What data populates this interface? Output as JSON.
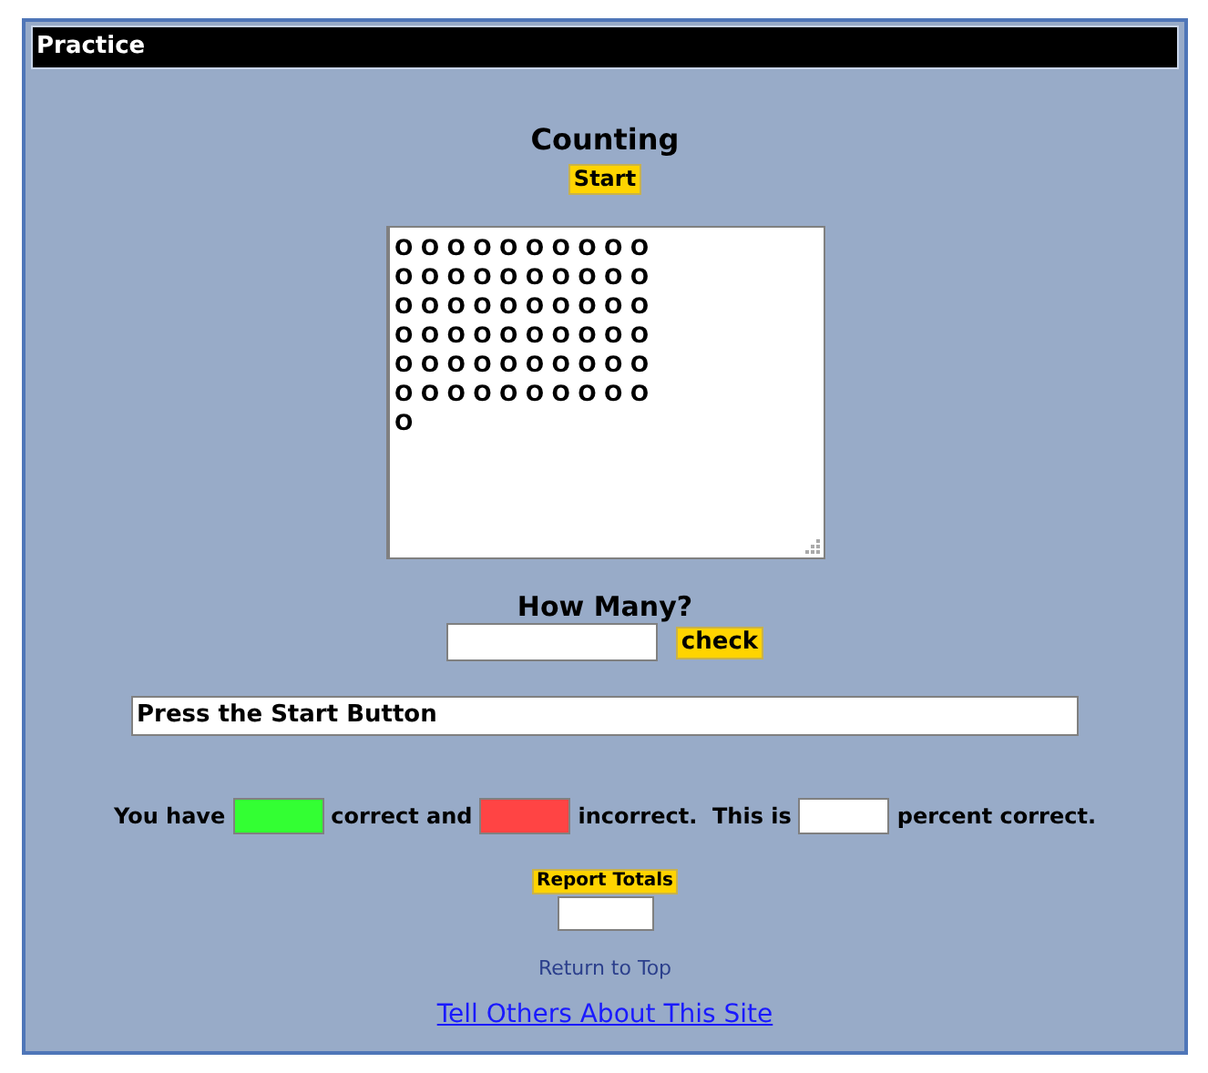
{
  "title_bar": "Practice",
  "heading": "Counting",
  "start_button": "Start",
  "display": {
    "lines": [
      "O O O O O O O O O O",
      "O O O O O O O O O O",
      "O O O O O O O O O O",
      "O O O O O O O O O O",
      "O O O O O O O O O O",
      "O O O O O O O O O O",
      "O"
    ]
  },
  "question": "How Many?",
  "check_button": "check",
  "message": "Press the Start Button",
  "score": [
    {
      "kind": "text",
      "text": "You have"
    },
    {
      "kind": "field",
      "color": "#33ff33"
    },
    {
      "kind": "text",
      "text": "correct and"
    },
    {
      "kind": "field",
      "color": "#ff4444"
    },
    {
      "kind": "text",
      "text": "incorrect.  This is"
    },
    {
      "kind": "field",
      "color": "#ffffff"
    },
    {
      "kind": "text",
      "text": "percent correct."
    }
  ],
  "report_button": "Report Totals",
  "return_link": "Return to Top",
  "tell_link": "Tell Others About This Site"
}
